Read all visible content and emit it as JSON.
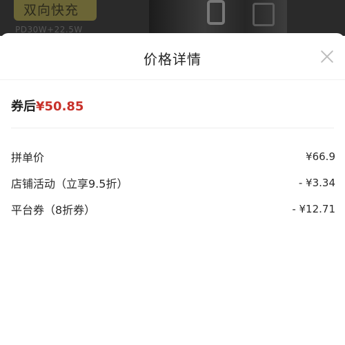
{
  "background": {
    "badge_text": "双向快充",
    "sub_text": "PD30W+22.5W"
  },
  "sheet": {
    "title": "价格详情",
    "close_icon": "close-icon"
  },
  "final_price": {
    "label": "券后",
    "amount": "¥50.85"
  },
  "price_rows": [
    {
      "label": "拼单价",
      "value": "¥66.9"
    },
    {
      "label": "店铺活动（立享9.5折）",
      "value": "- ¥3.34"
    },
    {
      "label": "平台券（8折券）",
      "value": "- ¥12.71"
    }
  ],
  "colors": {
    "accent_red": "#c8312a"
  }
}
